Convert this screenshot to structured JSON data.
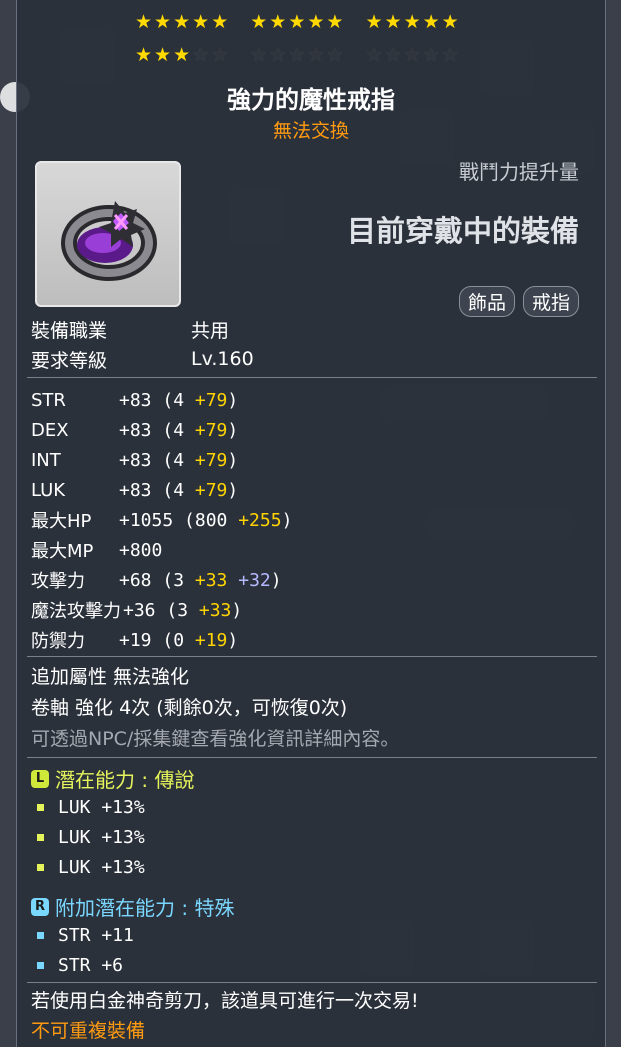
{
  "stars": {
    "row1": [
      [
        1,
        1,
        1,
        1,
        1
      ],
      [
        1,
        1,
        1,
        1,
        1
      ],
      [
        1,
        1,
        1,
        1,
        1
      ]
    ],
    "row2": [
      [
        1,
        1,
        1,
        0,
        0
      ],
      [
        0,
        0,
        0,
        0,
        0
      ],
      [
        0,
        0,
        0,
        0,
        0
      ]
    ],
    "on_color": "#ffd900"
  },
  "item": {
    "name": "強力的魔性戒指",
    "trade": "無法交換",
    "icon": "purple-ring-icon"
  },
  "power_label": "戰鬥力提升量",
  "equip_status": "目前穿戴中的裝備",
  "tags": [
    "飾品",
    "戒指"
  ],
  "requirements": [
    {
      "key": "裝備職業",
      "value": "共用"
    },
    {
      "key": "要求等級",
      "value": "Lv.160"
    }
  ],
  "stats": [
    {
      "name": "STR",
      "base": "+83",
      "open": " (4",
      "bonus1": " +79",
      "bonus2": "",
      "close": ")"
    },
    {
      "name": "DEX",
      "base": "+83",
      "open": " (4",
      "bonus1": " +79",
      "bonus2": "",
      "close": ")"
    },
    {
      "name": "INT",
      "base": "+83",
      "open": " (4",
      "bonus1": " +79",
      "bonus2": "",
      "close": ")"
    },
    {
      "name": "LUK",
      "base": "+83",
      "open": " (4",
      "bonus1": " +79",
      "bonus2": "",
      "close": ")"
    },
    {
      "name": "最大HP",
      "base": "+1055",
      "open": " (800",
      "bonus1": " +255",
      "bonus2": "",
      "close": ")"
    },
    {
      "name": "最大MP",
      "base": "+800",
      "open": "",
      "bonus1": "",
      "bonus2": "",
      "close": ""
    },
    {
      "name": "攻擊力",
      "base": "+68",
      "open": " (3",
      "bonus1": " +33",
      "bonus2": " +32",
      "close": ")"
    },
    {
      "name": "魔法攻擊力",
      "base": "+36",
      "open": " (3",
      "bonus1": " +33",
      "bonus2": "",
      "close": ")"
    },
    {
      "name": "防禦力",
      "base": "+19",
      "open": " (0",
      "bonus1": " +19",
      "bonus2": "",
      "close": ")"
    }
  ],
  "misc": {
    "extra": "追加屬性 無法強化",
    "scroll": "卷軸 強化 4次 (剩餘0次，可恢復0次)",
    "hint": "可透過NPC/採集鍵查看強化資訊詳細內容。"
  },
  "potential": {
    "badge": "L",
    "title": "潛在能力 : 傳說",
    "lines": [
      "LUK +13%",
      "LUK +13%",
      "LUK +13%"
    ]
  },
  "additional": {
    "badge": "R",
    "title": "附加潛在能力 : 特殊",
    "lines": [
      "STR +11",
      "STR +6"
    ]
  },
  "trade_note": "若使用白金神奇剪刀，該道具可進行一次交易!",
  "unique": "不可重複裝備"
}
